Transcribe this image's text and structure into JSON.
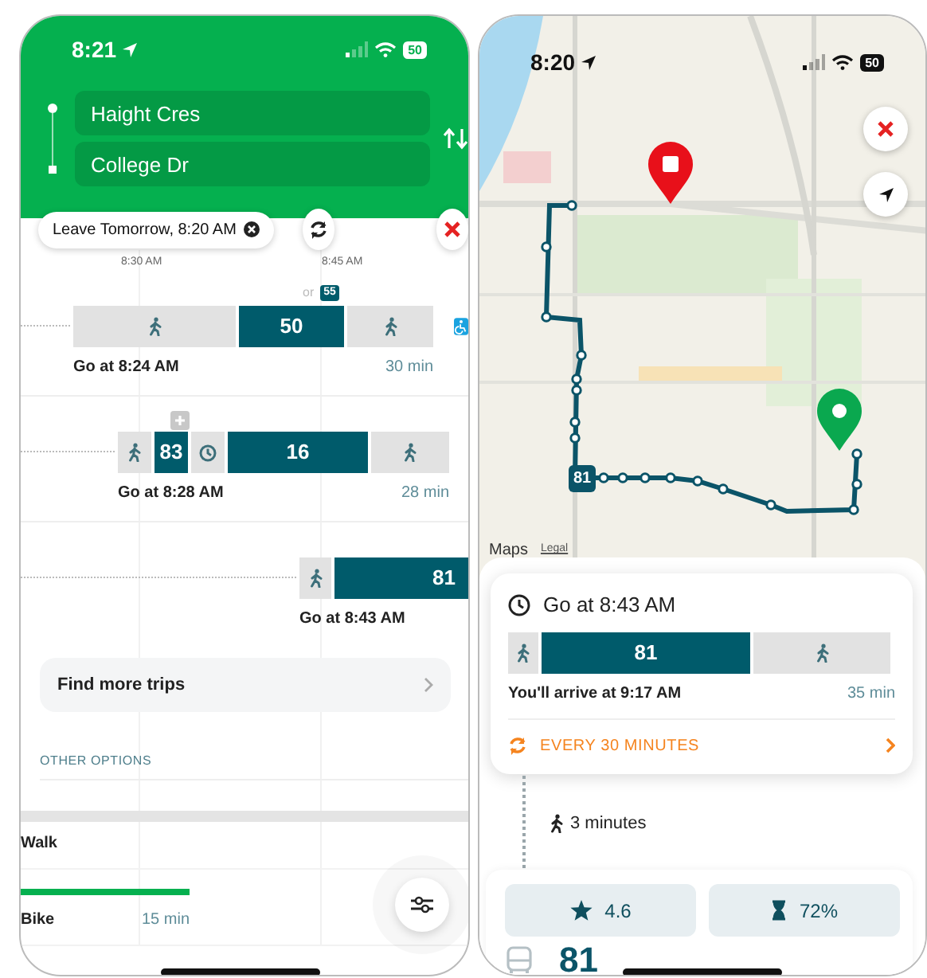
{
  "left_phone": {
    "status_bar": {
      "time": "8:21",
      "battery": "50"
    },
    "origin": "Haight Cres",
    "destination": "College Dr",
    "leave_chip": "Leave Tomorrow, 8:20 AM",
    "time_axis": [
      "8:30 AM",
      "8:45 AM"
    ],
    "trips": [
      {
        "alt_label": "or",
        "alt_route": "55",
        "segments": [
          {
            "kind": "walk"
          },
          {
            "kind": "bus",
            "route": "50"
          },
          {
            "kind": "walk"
          }
        ],
        "go": "Go at 8:24 AM",
        "duration": "30 min",
        "accessible": true,
        "expandable": false
      },
      {
        "segments": [
          {
            "kind": "walk"
          },
          {
            "kind": "bus",
            "route": "83"
          },
          {
            "kind": "wait"
          },
          {
            "kind": "bus",
            "route": "16"
          },
          {
            "kind": "walk"
          }
        ],
        "go": "Go at 8:28 AM",
        "duration": "28 min",
        "accessible": false,
        "expandable": true
      },
      {
        "segments": [
          {
            "kind": "walk"
          },
          {
            "kind": "bus",
            "route": "81"
          }
        ],
        "go": "Go at 8:43 AM",
        "accessible": false,
        "expandable": false
      }
    ],
    "find_more": "Find more trips",
    "other_options_heading": "OTHER OPTIONS",
    "options": [
      {
        "label": "Walk"
      },
      {
        "label": "Bike",
        "duration": "15 min"
      }
    ]
  },
  "right_phone": {
    "status_bar": {
      "time": "8:20",
      "battery": "50"
    },
    "map": {
      "kind": "picture",
      "route_badge": "81",
      "attribution": "Maps",
      "legal": "Legal"
    },
    "trip_card": {
      "go": "Go at 8:43 AM",
      "segments": [
        {
          "kind": "walk"
        },
        {
          "kind": "bus",
          "route": "81"
        },
        {
          "kind": "walk"
        }
      ],
      "arrive": "You'll arrive at 9:17 AM",
      "duration": "35 min",
      "frequency": "EVERY 30 MINUTES"
    },
    "walk_step": "3 minutes",
    "rating": "4.6",
    "crowding": "72%",
    "route": "81"
  }
}
